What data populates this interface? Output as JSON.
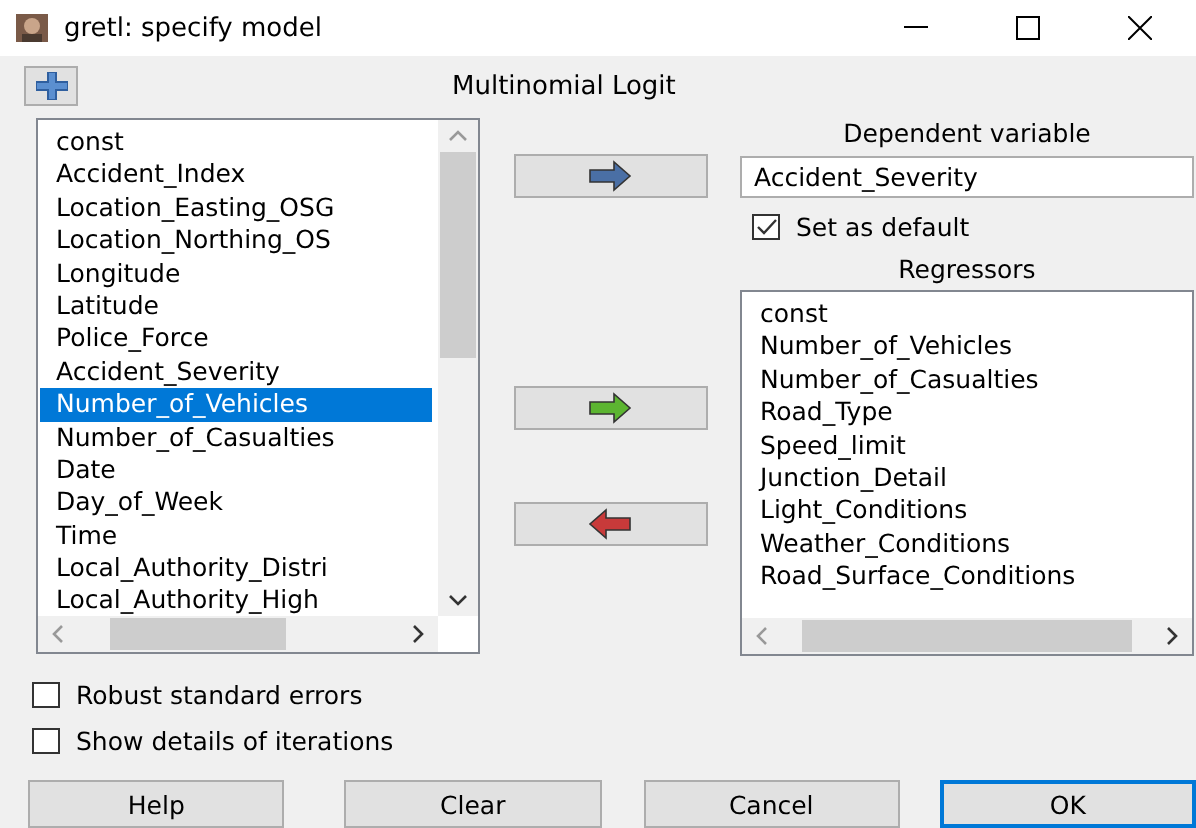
{
  "window": {
    "title": "gretl: specify model"
  },
  "dialog_title": "Multinomial Logit",
  "variables": [
    {
      "label": "const",
      "selected": false
    },
    {
      "label": "Accident_Index",
      "selected": false
    },
    {
      "label": "Location_Easting_OSG",
      "selected": false
    },
    {
      "label": "Location_Northing_OS",
      "selected": false
    },
    {
      "label": "Longitude",
      "selected": false
    },
    {
      "label": "Latitude",
      "selected": false
    },
    {
      "label": "Police_Force",
      "selected": false
    },
    {
      "label": "Accident_Severity",
      "selected": false
    },
    {
      "label": "Number_of_Vehicles",
      "selected": true
    },
    {
      "label": "Number_of_Casualties",
      "selected": false
    },
    {
      "label": "Date",
      "selected": false
    },
    {
      "label": "Day_of_Week",
      "selected": false
    },
    {
      "label": "Time",
      "selected": false
    },
    {
      "label": "Local_Authority_Distri",
      "selected": false
    },
    {
      "label": "Local_Authority_High",
      "selected": false
    }
  ],
  "dependent": {
    "label": "Dependent variable",
    "value": "Accident_Severity",
    "set_as_default": {
      "label": "Set as default",
      "checked": true
    }
  },
  "regressors": {
    "label": "Regressors",
    "items": [
      "const",
      "Number_of_Vehicles",
      "Number_of_Casualties",
      "Road_Type",
      "Speed_limit",
      "Junction_Detail",
      "Light_Conditions",
      "Weather_Conditions",
      "Road_Surface_Conditions"
    ]
  },
  "arrows": [
    {
      "kind": "blue-right"
    },
    {
      "kind": "green-right"
    },
    {
      "kind": "red-left"
    }
  ],
  "options": [
    {
      "label": "Robust standard errors",
      "checked": false
    },
    {
      "label": "Show details of iterations",
      "checked": false
    }
  ],
  "buttons": [
    {
      "label": "Help",
      "default": false
    },
    {
      "label": "Clear",
      "default": false
    },
    {
      "label": "Cancel",
      "default": false
    },
    {
      "label": "OK",
      "default": true
    }
  ]
}
